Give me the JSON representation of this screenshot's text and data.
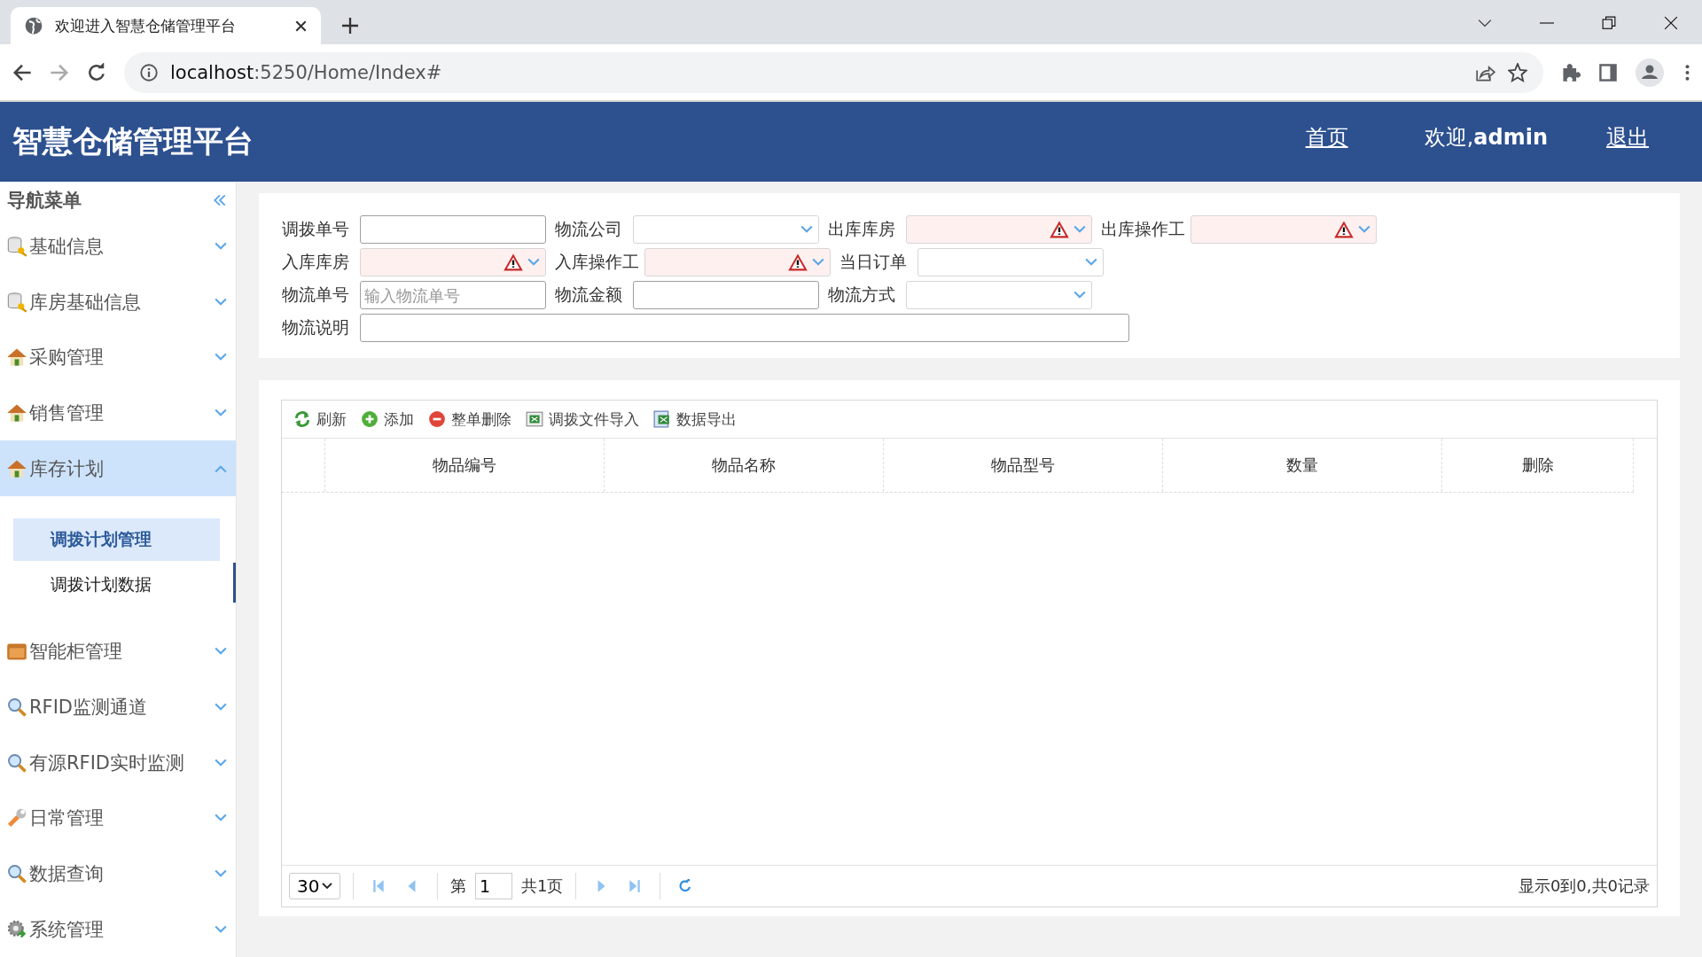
{
  "browser": {
    "tab_title": "欢迎进入智慧仓储管理平台",
    "url_host": "localhost",
    "url_rest": ":5250/Home/Index#"
  },
  "header": {
    "title": "智慧仓储管理平台",
    "links": [
      {
        "label": "首页",
        "kind": "link"
      },
      {
        "label": "欢迎,",
        "bold": "admin",
        "kind": "text"
      },
      {
        "label": "退出",
        "kind": "link"
      }
    ]
  },
  "sidebar": {
    "title": "导航菜单",
    "items": [
      {
        "label": "基础信息",
        "expanded": false
      },
      {
        "label": "库房基础信息",
        "expanded": false
      },
      {
        "label": "采购管理",
        "expanded": false
      },
      {
        "label": "销售管理",
        "expanded": false
      },
      {
        "label": "库存计划",
        "expanded": true,
        "children": [
          {
            "label": "调拨计划管理",
            "selected": true
          },
          {
            "label": "调拨计划数据",
            "selected": false
          }
        ]
      },
      {
        "label": "智能柜管理",
        "expanded": false
      },
      {
        "label": "RFID监测通道",
        "expanded": false
      },
      {
        "label": "有源RFID实时监测",
        "expanded": false
      },
      {
        "label": "日常管理",
        "expanded": false
      },
      {
        "label": "数据查询",
        "expanded": false
      },
      {
        "label": "系统管理",
        "expanded": false
      }
    ]
  },
  "form": {
    "rows": [
      [
        {
          "label": "调拨单号",
          "kind": "text"
        },
        {
          "label": "物流公司",
          "kind": "select",
          "invalid": false
        },
        {
          "label": "出库库房",
          "kind": "select",
          "invalid": true
        },
        {
          "label": "出库操作工",
          "kind": "select",
          "invalid": true
        }
      ],
      [
        {
          "label": "入库库房",
          "kind": "select",
          "invalid": true
        },
        {
          "label": "入库操作工",
          "kind": "select",
          "invalid": true
        },
        {
          "label": "当日订单",
          "kind": "select",
          "invalid": false
        }
      ],
      [
        {
          "label": "物流单号",
          "kind": "text",
          "placeholder": "输入物流单号"
        },
        {
          "label": "物流金额",
          "kind": "text"
        },
        {
          "label": "物流方式",
          "kind": "select",
          "invalid": false
        }
      ],
      [
        {
          "label": "物流说明",
          "kind": "wide"
        }
      ]
    ]
  },
  "toolbar": [
    {
      "label": "刷新"
    },
    {
      "label": "添加"
    },
    {
      "label": "整单删除"
    },
    {
      "label": "调拨文件导入"
    },
    {
      "label": "数据导出"
    }
  ],
  "table": {
    "columns": [
      "物品编号",
      "物品名称",
      "物品型号",
      "数量",
      "删除"
    ]
  },
  "pager": {
    "page_size": "30",
    "page_prefix": "第",
    "page": "1",
    "page_total": "共1页",
    "summary": "显示0到0,共0记录"
  }
}
